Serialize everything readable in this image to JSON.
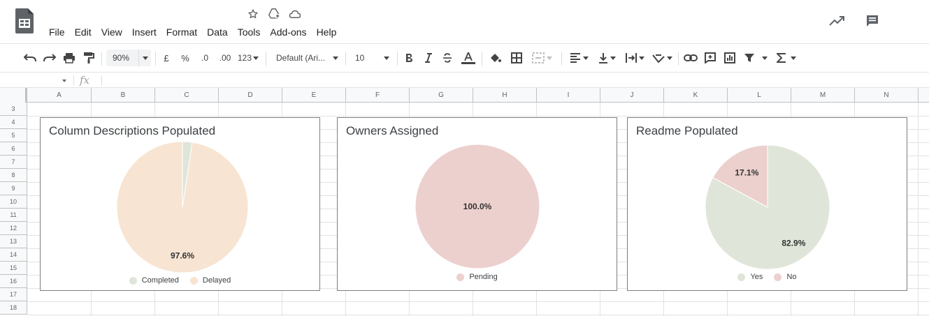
{
  "menu": [
    "File",
    "Edit",
    "View",
    "Insert",
    "Format",
    "Data",
    "Tools",
    "Add-ons",
    "Help"
  ],
  "toolbar": {
    "zoom": "90%",
    "currency": "£",
    "percent": "%",
    "dec_decrease": ".0",
    "dec_increase": ".00",
    "more_formats": "123",
    "font": "Default (Ari...",
    "font_size": "10"
  },
  "formula": {
    "fx": "fx"
  },
  "columns": [
    "A",
    "B",
    "C",
    "D",
    "E",
    "F",
    "G",
    "H",
    "I",
    "J",
    "K",
    "L",
    "M",
    "N"
  ],
  "rows": [
    "3",
    "4",
    "5",
    "6",
    "7",
    "8",
    "9",
    "10",
    "11",
    "12",
    "13",
    "14",
    "15",
    "16",
    "17",
    "18"
  ],
  "colors": {
    "green": "#dfe6d9",
    "peach": "#f8e4d2",
    "pink": "#ecd0ce"
  },
  "chart_data": [
    {
      "type": "pie",
      "title": "Column Descriptions Populated",
      "slices": [
        {
          "label": "Completed",
          "value": 2.4,
          "color": "#dfe6d9"
        },
        {
          "label": "Delayed",
          "value": 97.6,
          "color": "#f8e4d2"
        }
      ],
      "data_labels": [
        "",
        "97.6%"
      ],
      "legend": "bottom"
    },
    {
      "type": "pie",
      "title": "Owners Assigned",
      "slices": [
        {
          "label": "Pending",
          "value": 100.0,
          "color": "#ecd0ce"
        }
      ],
      "data_labels": [
        "100.0%"
      ],
      "legend": "bottom"
    },
    {
      "type": "pie",
      "title": "Readme Populated",
      "slices": [
        {
          "label": "Yes",
          "value": 82.9,
          "color": "#dfe6d9"
        },
        {
          "label": "No",
          "value": 17.1,
          "color": "#ecd0ce"
        }
      ],
      "data_labels": [
        "82.9%",
        "17.1%"
      ],
      "legend": "bottom"
    }
  ]
}
